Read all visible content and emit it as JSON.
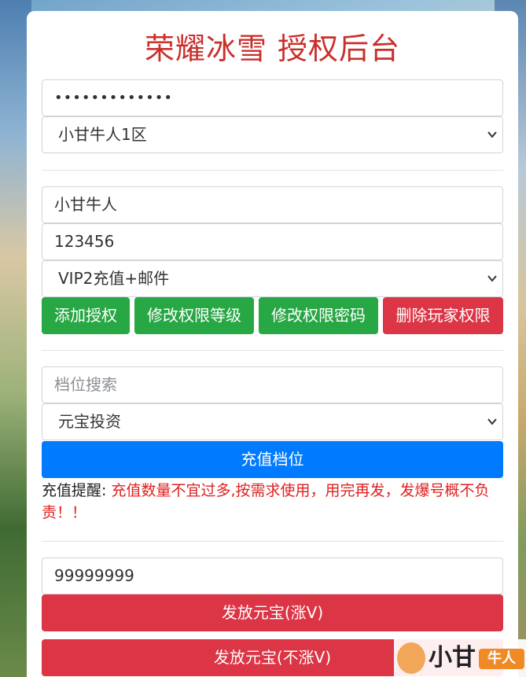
{
  "header": {
    "title": "荣耀冰雪 授权后台"
  },
  "login": {
    "password_value": "•••••••••••••",
    "server_selected": "小甘牛人1区"
  },
  "player": {
    "account_value": "小甘牛人",
    "password_value": "123456",
    "level_selected": "VIP2充值+邮件",
    "add_button": "添加授权",
    "modify_level_button": "修改权限等级",
    "modify_password_button": "修改权限密码",
    "delete_button": "删除玩家权限"
  },
  "recharge": {
    "search_placeholder": "档位搜索",
    "tier_selected": "元宝投资",
    "recharge_button": "充值档位",
    "notice_label": "充值提醒:",
    "notice_text": "充值数量不宜过多,按需求使用，用完再发，发爆号概不负责！！"
  },
  "yuanbao": {
    "amount_value": "99999999",
    "send_vip_button": "发放元宝(涨V)",
    "send_novip_button": "发放元宝(不涨V)"
  },
  "watermark": {
    "brand_text": "小甘",
    "badge_text": "牛人"
  },
  "colors": {
    "title": "#c9302c",
    "green": "#28a745",
    "red": "#dc3545",
    "blue": "#007bff",
    "warning_text": "#e02020"
  },
  "icons": {
    "select_arrow": "chevron-down-icon"
  }
}
